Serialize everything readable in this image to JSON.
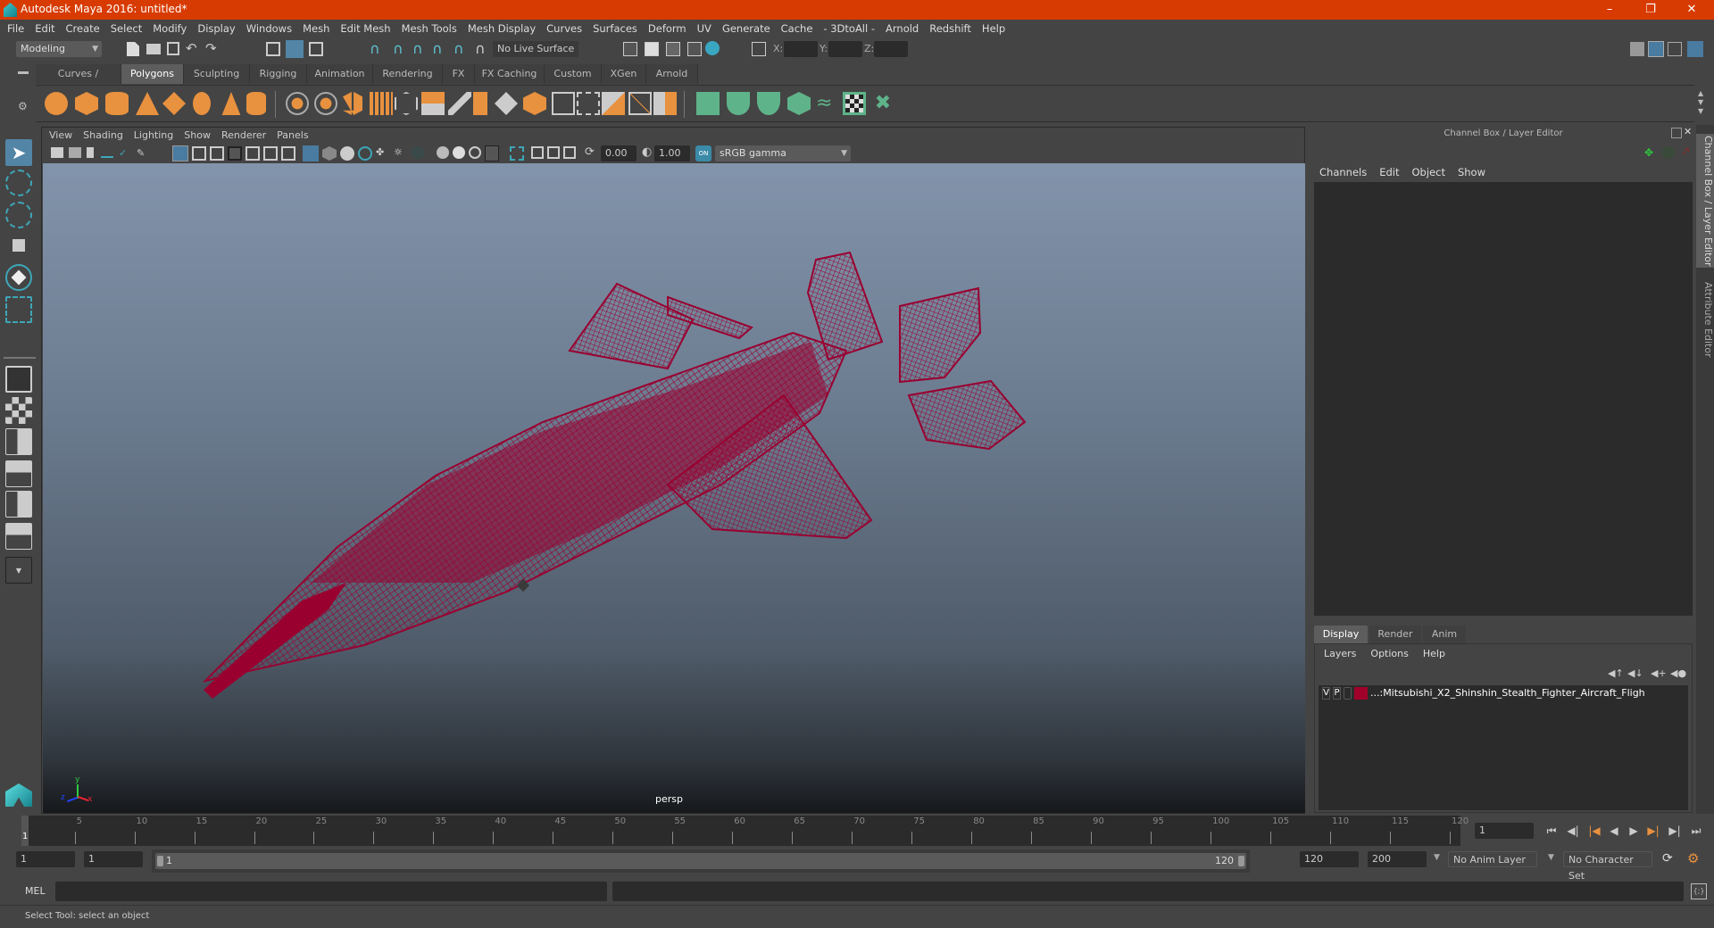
{
  "window": {
    "title": "Autodesk Maya 2016: untitled*",
    "controls": [
      "minimize",
      "restore",
      "close"
    ],
    "title_bar_color": "#d83b01"
  },
  "menubar": {
    "items": [
      "File",
      "Edit",
      "Create",
      "Select",
      "Modify",
      "Display",
      "Windows",
      "Mesh",
      "Edit Mesh",
      "Mesh Tools",
      "Mesh Display",
      "Curves",
      "Surfaces",
      "Deform",
      "UV",
      "Generate",
      "Cache",
      "- 3DtoAll -",
      "Arnold",
      "Redshift",
      "Help"
    ]
  },
  "statusline": {
    "menuset": "Modeling",
    "live_surface": "No Live Surface",
    "x_label": "X:",
    "y_label": "Y:",
    "z_label": "Z:",
    "x_value": "",
    "y_value": "",
    "z_value": ""
  },
  "shelf": {
    "tabs": [
      "Curves / Surfaces",
      "Polygons",
      "Sculpting",
      "Rigging",
      "Animation",
      "Rendering",
      "FX",
      "FX Caching",
      "Custom",
      "XGen",
      "Arnold"
    ],
    "active_tab": "Polygons",
    "icons": [
      "poly-sphere",
      "poly-cube",
      "poly-cylinder",
      "poly-cone",
      "poly-plane",
      "poly-torus",
      "poly-pyramid",
      "poly-pipe",
      "combine",
      "separate",
      "mirror",
      "smooth",
      "bevel",
      "extrude",
      "bridge",
      "multi-cut",
      "insert-edge-loop",
      "append-to-polygon",
      "target-weld",
      "quad-draw",
      "uv-editor",
      "planar-mapping",
      "cylindrical-mapping",
      "spherical-mapping",
      "automatic-mapping",
      "unfold",
      "uv-checker",
      "cut-uv-edges"
    ]
  },
  "toolbox": {
    "tools": [
      "select-tool",
      "lasso-tool",
      "paint-select-tool",
      "move-tool",
      "rotate-tool",
      "scale-tool"
    ],
    "layouts": [
      "single-perspective-view",
      "four-view",
      "persp-outliner",
      "persp-graph",
      "hypershade-persp",
      "persp-graph-hypershade",
      "more-layouts"
    ]
  },
  "viewport": {
    "menu": [
      "View",
      "Shading",
      "Lighting",
      "Show",
      "Renderer",
      "Panels"
    ],
    "exposure": "0.00",
    "gamma": "1.00",
    "color_space": "sRGB gamma",
    "camera_label": "persp",
    "wireframe_color": "#990030",
    "axis": {
      "x": "x",
      "y": "y",
      "z": "z"
    }
  },
  "channel_box": {
    "title": "Channel Box / Layer Editor",
    "menu": [
      "Channels",
      "Edit",
      "Object",
      "Show"
    ]
  },
  "layer_editor": {
    "tabs": [
      "Display",
      "Render",
      "Anim"
    ],
    "active_tab": "Display",
    "menu": [
      "Layers",
      "Options",
      "Help"
    ],
    "layers": [
      {
        "visible": "V",
        "playback": "P",
        "color": "#a0002a",
        "name": "...:Mitsubishi_X2_Shinshin_Stealth_Fighter_Aircraft_Fligh"
      }
    ]
  },
  "side_tabs": [
    "Channel Box / Layer Editor",
    "Attribute Editor"
  ],
  "timeline": {
    "ticks": [
      5,
      10,
      15,
      20,
      25,
      30,
      35,
      40,
      45,
      50,
      55,
      60,
      65,
      70,
      75,
      80,
      85,
      90,
      95,
      100,
      105,
      110,
      115,
      120
    ],
    "current_frame_marker": "1",
    "current_frame": "1",
    "start": 1,
    "end": 120
  },
  "range": {
    "start_time": "1",
    "playback_start": "1",
    "slider_start": "1",
    "slider_end": "120",
    "playback_end": "120",
    "end_time": "200",
    "anim_layer": "No Anim Layer",
    "character_set": "No Character Set"
  },
  "command_line": {
    "language": "MEL",
    "input": "",
    "output": ""
  },
  "help_line": "Select Tool: select an object"
}
